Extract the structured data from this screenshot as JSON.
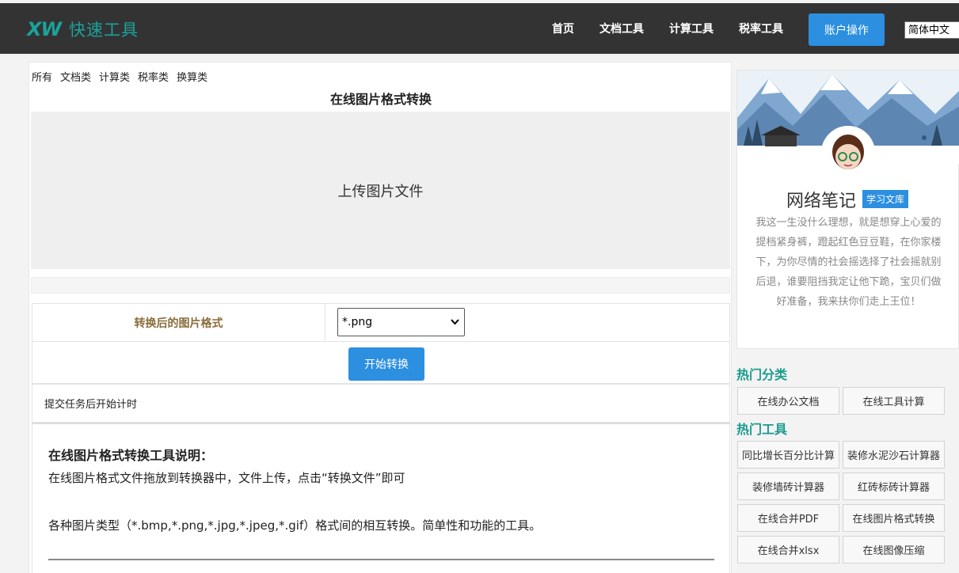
{
  "header": {
    "logo_mark": "XW",
    "logo_text": "快速工具",
    "nav": [
      "首页",
      "文档工具",
      "计算工具",
      "税率工具"
    ],
    "account_button": "账户操作",
    "language": "简体中文"
  },
  "main": {
    "categories": [
      "所有",
      "文档类",
      "计算类",
      "税率类",
      "换算类"
    ],
    "title": "在线图片格式转换",
    "upload_label": "上传图片文件",
    "format_label": "转换后的图片格式",
    "format_value": "*.png",
    "convert_button": "开始转换",
    "timer_text": "提交任务后开始计时",
    "description": {
      "title": "在线图片格式转换工具说明：",
      "line1": "在线图片格式文件拖放到转换器中，文件上传，点击“转换文件”即可",
      "line2": "各种图片类型（*.bmp,*.png,*.jpg,*.jpeg,*.gif）格式间的相互转换。简单性和功能的工具。"
    }
  },
  "sidebar": {
    "profile_name": "网络笔记",
    "profile_badge": "学习文库",
    "profile_bio": "我这一生没什么理想，就是想穿上心爱的提档紧身裤，蹬起红色豆豆鞋，在你家楼下，为你尽情的社会摇选择了社会摇就别后退，谁要阻挡我定让他下跪，宝贝们做好准备，我来扶你们走上王位！",
    "hot_categories_title": "热门分类",
    "hot_categories": [
      "在线办公文档",
      "在线工具计算"
    ],
    "hot_tools_title": "热门工具",
    "hot_tools": [
      "同比增长百分比计算",
      "装修水泥沙石计算器",
      "装修墙砖计算器",
      "红砖标砖计算器",
      "在线合并PDF",
      "在线图片格式转换",
      "在线合并xlsx",
      "在线图像压缩"
    ]
  },
  "colors": {
    "header_bg": "#333333",
    "accent_blue": "#2c8fe0",
    "brand_teal": "#1aa39a",
    "label_gold": "#8a6d3b"
  }
}
